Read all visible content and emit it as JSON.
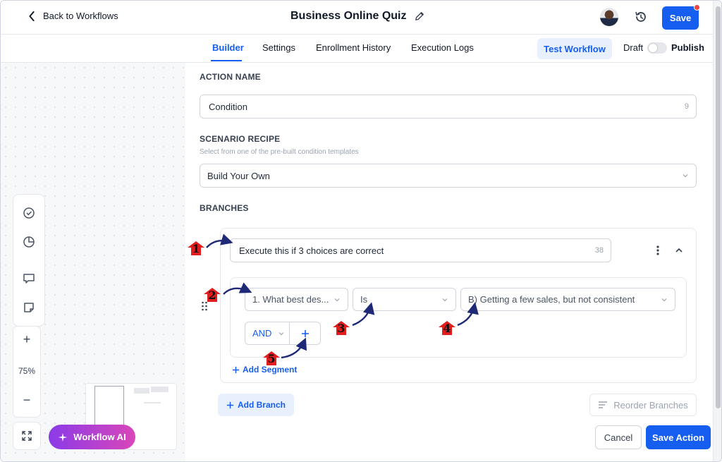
{
  "header": {
    "back_label": "Back to Workflows",
    "title": "Business Online Quiz",
    "save_label": "Save"
  },
  "tabs": {
    "items": [
      {
        "label": "Builder",
        "active": true
      },
      {
        "label": "Settings"
      },
      {
        "label": "Enrollment History"
      },
      {
        "label": "Execution Logs"
      }
    ],
    "test_workflow_label": "Test Workflow",
    "draft_label": "Draft",
    "publish_label": "Publish"
  },
  "canvas": {
    "zoom_plus": "+",
    "zoom_level": "75%",
    "zoom_minus": "−",
    "ai_label": "Workflow AI"
  },
  "panel": {
    "action_name": {
      "label": "ACTION NAME",
      "value": "Condition",
      "count": "9"
    },
    "scenario": {
      "label": "SCENARIO RECIPE",
      "help": "Select from one of the pre-built condition templates",
      "value": "Build Your Own"
    },
    "branches": {
      "label": "BRANCHES",
      "branch_name": "Execute this if 3 choices are correct",
      "branch_count": "38",
      "segment": {
        "field": "1. What best des...",
        "operator": "Is",
        "value": "B) Getting a few sales, but not consistent"
      },
      "logic": "AND",
      "add_segment": "Add Segment",
      "add_branch": "Add Branch",
      "reorder": "Reorder Branches"
    },
    "cancel_label": "Cancel",
    "save_action_label": "Save Action"
  },
  "annotations": [
    "1",
    "2",
    "3",
    "4",
    "5"
  ],
  "colors": {
    "accent": "#155eef",
    "annotation": "#e11d1d",
    "arrow": "#1e2a78"
  }
}
